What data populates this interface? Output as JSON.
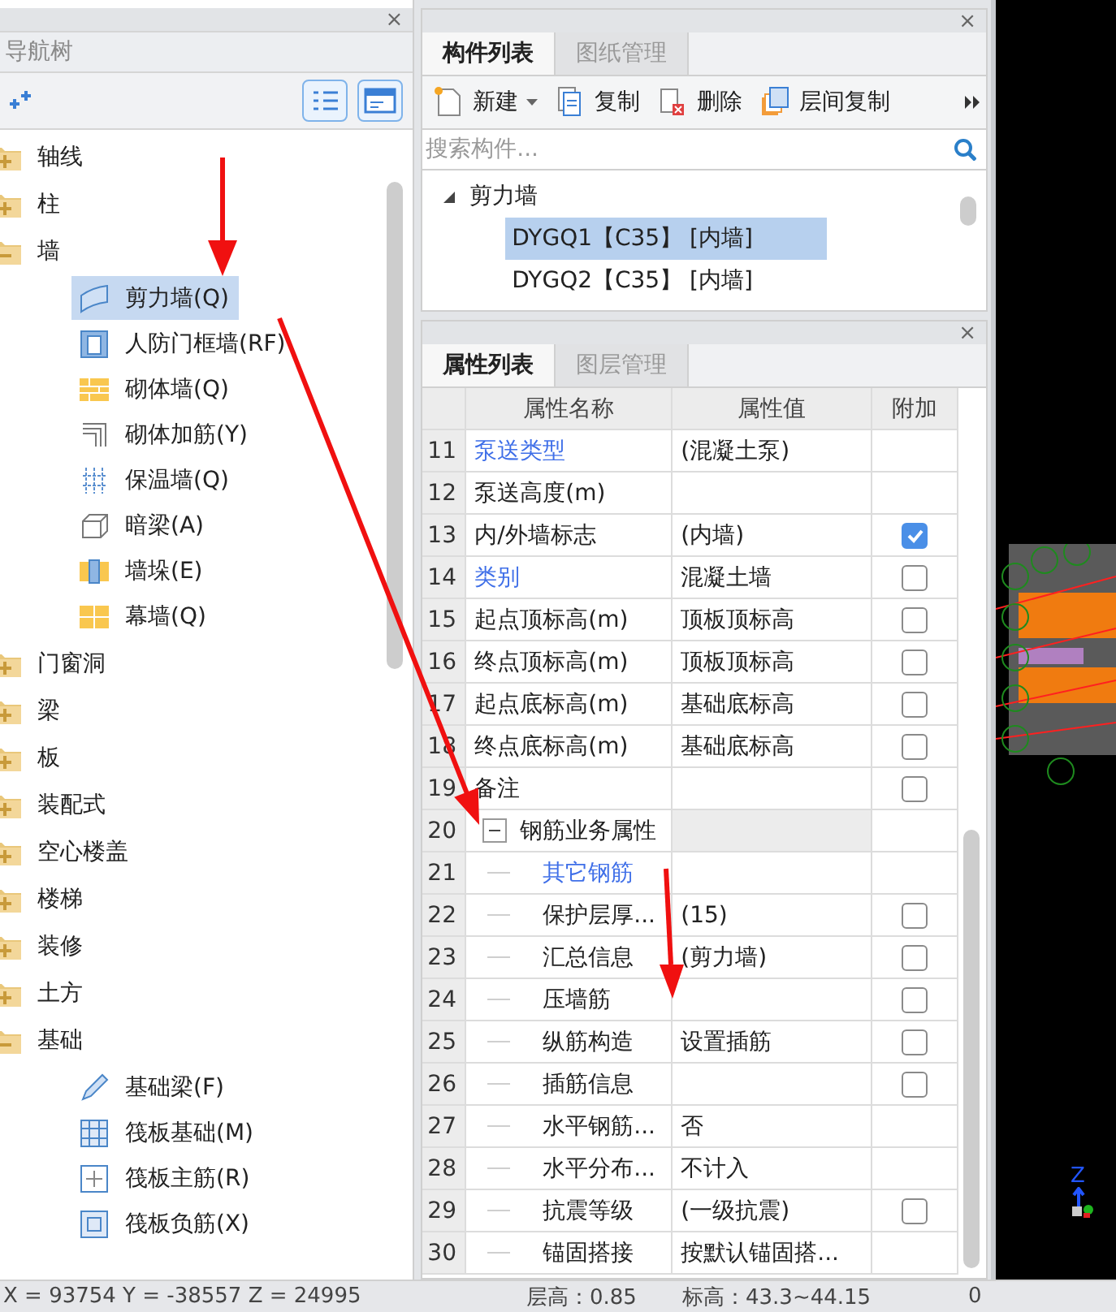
{
  "nav_panel": {
    "close": "×",
    "title": "导航树",
    "tree": [
      {
        "label": "轴线",
        "expanded": false,
        "selected": false
      },
      {
        "label": "柱",
        "expanded": false,
        "selected": false
      },
      {
        "label": "墙",
        "expanded": true,
        "selected": false,
        "children": [
          {
            "label": "剪力墙(Q)",
            "selected": true
          },
          {
            "label": "人防门框墙(RF)",
            "selected": false
          },
          {
            "label": "砌体墙(Q)",
            "selected": false
          },
          {
            "label": "砌体加筋(Y)",
            "selected": false
          },
          {
            "label": "保温墙(Q)",
            "selected": false
          },
          {
            "label": "暗梁(A)",
            "selected": false
          },
          {
            "label": "墙垛(E)",
            "selected": false
          },
          {
            "label": "幕墙(Q)",
            "selected": false
          }
        ]
      },
      {
        "label": "门窗洞",
        "expanded": false,
        "selected": false
      },
      {
        "label": "梁",
        "expanded": false,
        "selected": false
      },
      {
        "label": "板",
        "expanded": false,
        "selected": false
      },
      {
        "label": "装配式",
        "expanded": false,
        "selected": false
      },
      {
        "label": "空心楼盖",
        "expanded": false,
        "selected": false
      },
      {
        "label": "楼梯",
        "expanded": false,
        "selected": false
      },
      {
        "label": "装修",
        "expanded": false,
        "selected": false
      },
      {
        "label": "土方",
        "expanded": false,
        "selected": false
      },
      {
        "label": "基础",
        "expanded": true,
        "selected": false,
        "children": [
          {
            "label": "基础梁(F)",
            "selected": false
          },
          {
            "label": "筏板基础(M)",
            "selected": false
          },
          {
            "label": "筏板主筋(R)",
            "selected": false
          },
          {
            "label": "筏板负筋(X)",
            "selected": false
          }
        ]
      }
    ]
  },
  "component_panel": {
    "close": "×",
    "tabs": [
      {
        "label": "构件列表",
        "selected": true
      },
      {
        "label": "图纸管理",
        "selected": false
      }
    ],
    "toolbar": [
      {
        "label": "新建",
        "kind": "dropdown"
      },
      {
        "label": "复制",
        "kind": "button"
      },
      {
        "label": "删除",
        "kind": "button"
      },
      {
        "label": "层间复制",
        "kind": "button"
      }
    ],
    "search": {
      "placeholder": "搜索构件..."
    },
    "tree": [
      {
        "label": "剪力墙",
        "expanded": true,
        "selected": false,
        "children": [
          {
            "label": "DYGQ1【C35】 [内墙]",
            "selected": true
          },
          {
            "label": "DYGQ2【C35】 [内墙]",
            "selected": false
          }
        ]
      }
    ]
  },
  "property_panel": {
    "close": "×",
    "tabs": [
      {
        "label": "属性列表",
        "selected": true
      },
      {
        "label": "图层管理",
        "selected": false
      }
    ],
    "columns": [
      "属性名称",
      "属性值",
      "附加"
    ],
    "rows": [
      {
        "number": "11",
        "name": "泵送类型",
        "value": "(混凝土泵)",
        "kind": "link"
      },
      {
        "number": "12",
        "name": "泵送高度(m)",
        "kind": "text"
      },
      {
        "number": "13",
        "name": "内/外墙标志",
        "value": "(内墙)",
        "kind": "text",
        "checked": true
      },
      {
        "number": "14",
        "name": "类别",
        "value": "混凝土墙",
        "kind": "link",
        "checked": false
      },
      {
        "number": "15",
        "name": "起点顶标高(m)",
        "value": "顶板顶标高",
        "kind": "text",
        "checked": false
      },
      {
        "number": "16",
        "name": "终点顶标高(m)",
        "value": "顶板顶标高",
        "kind": "text",
        "checked": false
      },
      {
        "number": "17",
        "name": "起点底标高(m)",
        "value": "基础底标高",
        "kind": "text",
        "checked": false
      },
      {
        "number": "18",
        "name": "终点底标高(m)",
        "value": "基础底标高",
        "kind": "text",
        "checked": false
      },
      {
        "number": "19",
        "name": "备注",
        "kind": "text",
        "checked": false
      },
      {
        "number": "20",
        "name": "钢筋业务属性",
        "kind": "group",
        "expanded": true,
        "children": [
          {
            "number": "21",
            "name": "其它钢筋",
            "kind": "link"
          },
          {
            "number": "22",
            "name": "保护层厚...",
            "value": "(15)",
            "kind": "text",
            "checked": false
          },
          {
            "number": "23",
            "name": "汇总信息",
            "value": "(剪力墙)",
            "kind": "text",
            "checked": false
          },
          {
            "number": "24",
            "name": "压墙筋",
            "kind": "text",
            "checked": false
          },
          {
            "number": "25",
            "name": "纵筋构造",
            "value": "设置插筋",
            "kind": "text",
            "checked": false
          },
          {
            "number": "26",
            "name": "插筋信息",
            "kind": "text",
            "checked": false
          },
          {
            "number": "27",
            "name": "水平钢筋...",
            "value": "否",
            "kind": "text"
          },
          {
            "number": "28",
            "name": "水平分布...",
            "value": "不计入",
            "kind": "text"
          },
          {
            "number": "29",
            "name": "抗震等级",
            "value": "(一级抗震)",
            "kind": "text",
            "checked": false
          },
          {
            "number": "30",
            "name": "锚固搭接",
            "value": "按默认锚固搭...",
            "kind": "text"
          }
        ]
      }
    ]
  },
  "viewport": {
    "axis_label": "Z"
  },
  "status_bar": {
    "coordinates": "X = 93754 Y = -38557 Z = 24995",
    "floor_height": "层高：0.85",
    "elevation": "标高：43.3~44.15",
    "value": "0"
  }
}
